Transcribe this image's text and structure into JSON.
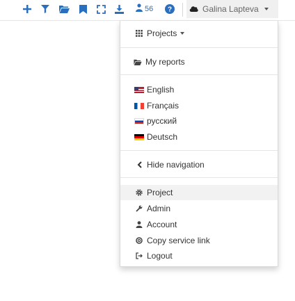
{
  "toolbar": {
    "icons": [
      "plus-icon",
      "filter-icon",
      "folder-icon",
      "bookmark-icon",
      "expand-icon",
      "download-icon",
      "users-icon",
      "help-icon"
    ],
    "users_count": "56",
    "accent": "#2a6fbe"
  },
  "user_menu": {
    "name": "Galina Lapteva",
    "avatar_icon": "cloud-icon"
  },
  "dropdown": {
    "projects_label": "Projects",
    "my_reports_label": "My reports",
    "languages": [
      {
        "label": "English",
        "flag": "us-flag-icon"
      },
      {
        "label": "Français",
        "flag": "fr-flag-icon"
      },
      {
        "label": "русский",
        "flag": "ru-flag-icon"
      },
      {
        "label": "Deutsch",
        "flag": "de-flag-icon"
      }
    ],
    "hide_navigation_label": "Hide navigation",
    "settings": [
      {
        "label": "Project",
        "icon": "gear-icon"
      },
      {
        "label": "Admin",
        "icon": "wrench-icon"
      },
      {
        "label": "Account",
        "icon": "user-icon"
      },
      {
        "label": "Copy service link",
        "icon": "lifebuoy-icon"
      },
      {
        "label": "Logout",
        "icon": "logout-icon"
      }
    ]
  }
}
